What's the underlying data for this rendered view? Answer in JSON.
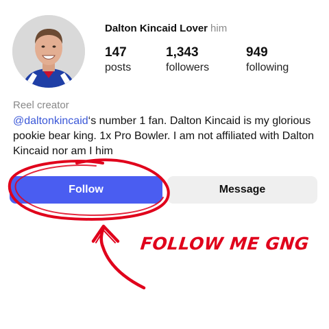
{
  "profile": {
    "name": "Dalton Kincaid Lover",
    "pronoun": "him",
    "avatar_desc": "profile photo"
  },
  "stats": [
    {
      "value": "147",
      "label": "posts"
    },
    {
      "value": "1,343",
      "label": "followers"
    },
    {
      "value": "949",
      "label": "following"
    }
  ],
  "bio": {
    "category": "Reel creator",
    "mention": "@daltonkincaid",
    "text": "‘s number 1 fan. Dalton Kincaid is my glorious pookie bear king. 1x Pro Bowler. I am not affiliated with Dalton Kincaid nor am I him"
  },
  "actions": {
    "follow_label": "Follow",
    "message_label": "Message"
  },
  "annotation": {
    "text": "FOLLOW ME GNG",
    "color": "#e0001b"
  },
  "colors": {
    "follow_button": "#4a5df1",
    "message_button": "#efefef",
    "mention": "#3a57d8"
  }
}
